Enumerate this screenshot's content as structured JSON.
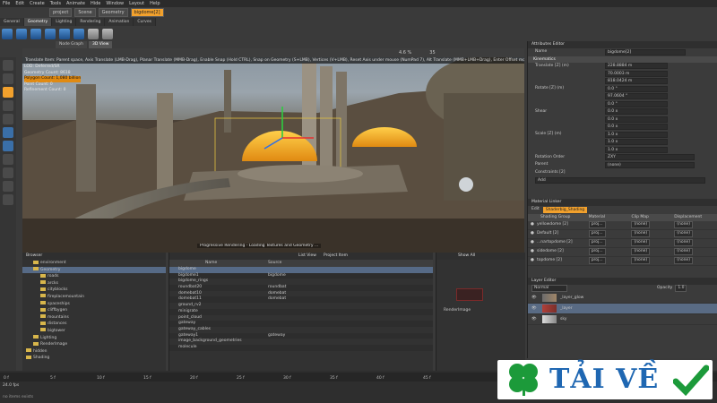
{
  "menubar": [
    "File",
    "Edit",
    "Create",
    "Tools",
    "Animate",
    "Hide",
    "Window",
    "Layout",
    "Help"
  ],
  "breadcrumb": [
    "project",
    "Scene",
    "Geometry",
    "bigdome[2]"
  ],
  "tabs": [
    "General",
    "Geometry",
    "Lighting",
    "Rendering",
    "Animation",
    "Curves"
  ],
  "viewport": {
    "tabs": [
      "Node Graph",
      "3D View"
    ],
    "zoom": "4.6 %",
    "frame": "35",
    "hint": "Translate Item: Parent space, Axis Translate (LMB-Drag), Planar Translate (MMB-Drag), Enable Snap (Hold CTRL), Snap on Geometry (S+LMB), Vertices (V+LMB), Reset Axis under mouse (NumPad 7), Alt Translate (MMB+LMB+Drag), Enter Offset mode (Hold TAB)",
    "stats": [
      "LOD: Deferred/SR",
      "Geometry Count: 8618",
      "Polygon Count: 1,080 billion",
      "Point Count: 0",
      "Refinement Count: 0"
    ],
    "footer": "Progressive Rendering - Loading Textures and Geometry ..."
  },
  "attribute_editor": {
    "title": "Attributes Editor",
    "name_label": "Name",
    "section": "Kinematics",
    "rows": [
      {
        "label": "Translate [Z] (m)",
        "values": [
          "228.8884 m",
          "70.0003 m",
          "818.0424 m"
        ]
      },
      {
        "label": "Rotate [Z] (m)",
        "values": [
          "0.0 °",
          "97.0604 °",
          "0.0 °"
        ]
      },
      {
        "label": "Shear",
        "values": [
          "0.0 x",
          "0.0 x",
          "0.0 x"
        ]
      },
      {
        "label": "Scale [Z] (m)",
        "values": [
          "1.0 x",
          "1.0 x",
          "1.0 x"
        ]
      }
    ],
    "rotation_order_label": "Rotation Order",
    "rotation_order": "ZXY",
    "parent_label": "Parent",
    "parent": "(none)",
    "constraints_label": "Constraints [2]",
    "add_label": "Add"
  },
  "material_linker": {
    "title": "Material Linker",
    "edit_label": "Edit",
    "current": "Shaderbig_Shading",
    "columns": [
      "Shading Group",
      "Material",
      "Clip Map",
      "Displacement"
    ],
    "rows": [
      {
        "group": "yellowdome [2]",
        "material": "proj...",
        "clip": "(none)",
        "disp": "(none)"
      },
      {
        "group": "Default [2]",
        "material": "proj...",
        "clip": "(none)",
        "disp": "(none)"
      },
      {
        "group": "...nartopdome [2]",
        "material": "proj...",
        "clip": "(none)",
        "disp": "(none)"
      },
      {
        "group": "sidedome [2]",
        "material": "proj...",
        "clip": "(none)",
        "disp": "(none)"
      },
      {
        "group": "topdome [2]",
        "material": "proj...",
        "clip": "(none)",
        "disp": "(none)"
      }
    ]
  },
  "layer_editor": {
    "title": "Layer Editor",
    "blend": "Normal",
    "opacity_label": "Opacity",
    "opacity": "1.0",
    "layers": [
      "_layer_glow",
      "_layer",
      "sky"
    ]
  },
  "browser": {
    "title": "Browser",
    "items": [
      {
        "label": "environment",
        "depth": 1
      },
      {
        "label": "Geometry",
        "depth": 1
      },
      {
        "label": "roads",
        "depth": 2
      },
      {
        "label": "arcks",
        "depth": 2
      },
      {
        "label": "cityblocks",
        "depth": 2
      },
      {
        "label": "fireplacemountain",
        "depth": 2
      },
      {
        "label": "spaceships",
        "depth": 2
      },
      {
        "label": "cliffbygen",
        "depth": 2
      },
      {
        "label": "mountains",
        "depth": 2
      },
      {
        "label": "distances",
        "depth": 2
      },
      {
        "label": "bigtower",
        "depth": 2
      },
      {
        "label": "Lighting",
        "depth": 1
      },
      {
        "label": "RenderImage",
        "depth": 1
      },
      {
        "label": "hidden",
        "depth": 0
      },
      {
        "label": "Shading",
        "depth": 0
      }
    ]
  },
  "list_panel": {
    "view_label": "List View",
    "filter_label": "Project Item",
    "columns": [
      "Name",
      "Source"
    ],
    "rows": [
      {
        "name": "bigdome",
        "source": ""
      },
      {
        "name": "bigdome1",
        "source": "bigdome"
      },
      {
        "name": "bigdome_rings",
        "source": ""
      },
      {
        "name": "roundbat20",
        "source": "roundbat"
      },
      {
        "name": "domebat10",
        "source": "domebat"
      },
      {
        "name": "domebat11",
        "source": "domebat"
      },
      {
        "name": "ground_rv2",
        "source": ""
      },
      {
        "name": "minigrate",
        "source": ""
      },
      {
        "name": "point_cloud",
        "source": ""
      },
      {
        "name": "gateway",
        "source": ""
      },
      {
        "name": "gateway_cables",
        "source": ""
      },
      {
        "name": "gateway1",
        "source": "gateway"
      },
      {
        "name": "image_background_geometries",
        "source": ""
      },
      {
        "name": "molecule",
        "source": ""
      }
    ]
  },
  "render_panel": {
    "label": "RenderImage",
    "show_label": "Show All"
  },
  "timeline": {
    "ticks": [
      "0 f",
      "5 f",
      "10 f",
      "15 f",
      "20 f",
      "25 f",
      "30 f",
      "35 f",
      "40 f",
      "45 f"
    ],
    "fps": "24.0 fps",
    "status": "no items exists"
  },
  "logo": {
    "text": "TẢI VỀ"
  }
}
